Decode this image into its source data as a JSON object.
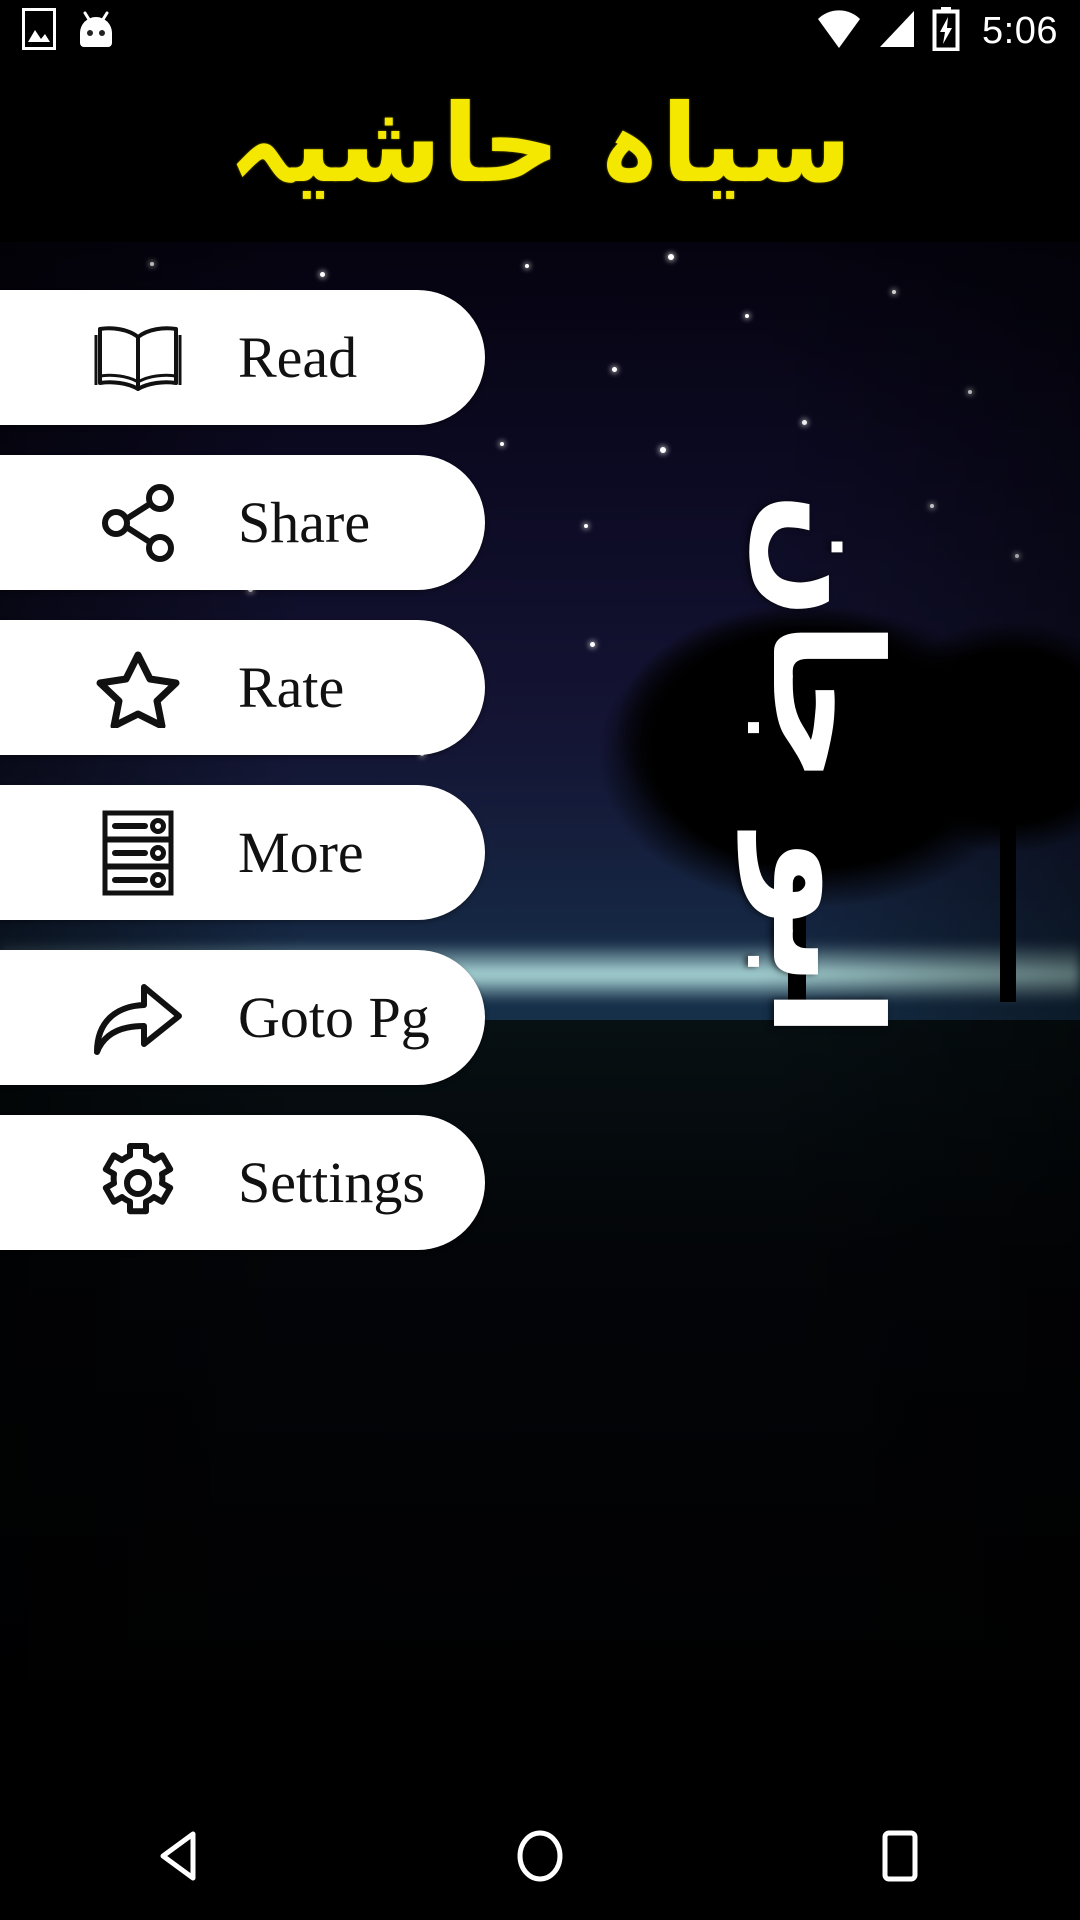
{
  "status_bar": {
    "time": "5:06",
    "icons": [
      {
        "name": "image-icon",
        "label": "screenshot"
      },
      {
        "name": "android-head-icon",
        "label": "android"
      },
      {
        "name": "wifi-icon",
        "label": "wifi"
      },
      {
        "name": "cellular-signal-icon",
        "label": "signal"
      },
      {
        "name": "battery-charging-icon",
        "label": "charging"
      }
    ]
  },
  "header": {
    "title": "سیاہ حاشیہ",
    "title_color": "#F5E800",
    "background_color": "#000000"
  },
  "background": {
    "calligraphy": "ابو جان",
    "calligraphy_color": "#FFFFFF",
    "scene": "night-sky-with-tree-silhouette"
  },
  "menu": {
    "items": [
      {
        "icon": "open-book-icon",
        "label": "Read"
      },
      {
        "icon": "share-nodes-icon",
        "label": "Share"
      },
      {
        "icon": "star-outline-icon",
        "label": "Rate"
      },
      {
        "icon": "server-rack-icon",
        "label": "More"
      },
      {
        "icon": "curved-forward-arrow-icon",
        "label": "Goto Pg"
      },
      {
        "icon": "gear-icon",
        "label": "Settings"
      }
    ],
    "button_color": "#FFFFFF",
    "label_color": "#111111"
  },
  "nav_bar": {
    "buttons": [
      {
        "name": "back-button",
        "icon": "triangle-left-icon"
      },
      {
        "name": "home-button",
        "icon": "circle-icon"
      },
      {
        "name": "recents-button",
        "icon": "square-icon"
      }
    ]
  }
}
